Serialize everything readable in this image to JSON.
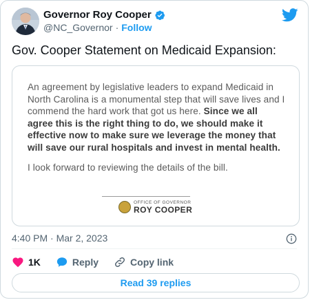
{
  "author": {
    "name": "Governor Roy Cooper",
    "handle": "@NC_Governor",
    "separator": "·",
    "follow_label": "Follow",
    "avatar_icon": "person-portrait"
  },
  "tweet": {
    "text": "Gov. Cooper Statement on Medicaid Expansion:",
    "timestamp": "4:40 PM · Mar 2, 2023"
  },
  "statement": {
    "intro": "An agreement by legislative leaders to expand Medicaid in North Carolina is a monumental step that will save lives and I commend the hard work that got us here. ",
    "bold": "Since we all agree this is the right thing to do, we should make it effective now to make sure we leverage the money that will save our rural hospitals and invest in mental health.",
    "closing": "I look forward to reviewing the details of the bill.",
    "office_line": "OFFICE OF GOVERNOR",
    "office_name": "ROY COOPER"
  },
  "actions": {
    "like_count": "1K",
    "reply_label": "Reply",
    "copy_link_label": "Copy link"
  },
  "replies_button": "Read 39 replies",
  "colors": {
    "accent": "#1d9bf0",
    "like": "#f91880",
    "text": "#0f1419",
    "secondary": "#536471",
    "border": "#cfd9de"
  }
}
